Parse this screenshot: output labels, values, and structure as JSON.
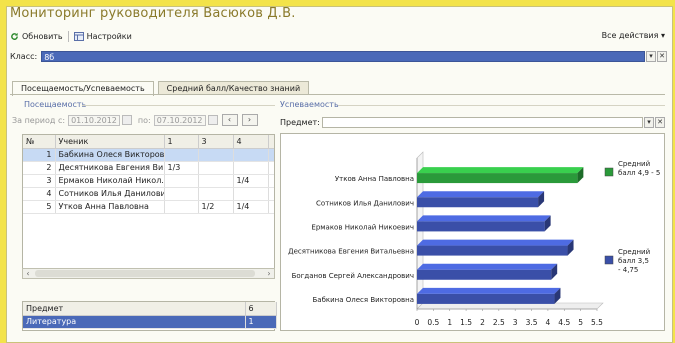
{
  "window": {
    "title": "Мониторинг руководителя Васюков Д.В."
  },
  "toolbar": {
    "refresh_label": "Обновить",
    "settings_label": "Настройки",
    "all_actions_label": "Все действия ▾"
  },
  "class_field": {
    "label": "Класс:",
    "value": "8б"
  },
  "tabs": [
    {
      "label": "Посещаемость/Успеваемость",
      "active": true
    },
    {
      "label": "Средний балл/Качество знаний",
      "active": false
    }
  ],
  "attendance": {
    "group_label": "Посещаемость",
    "period_from_label": "За период с:",
    "period_from": "01.10.2012",
    "period_to_label": "по:",
    "period_to": "07.10.2012",
    "prev_icon": "chevron-left-icon",
    "next_icon": "chevron-right-icon",
    "columns": [
      "№",
      "Ученик",
      "1",
      "3",
      "4",
      ""
    ],
    "rows": [
      {
        "n": "1",
        "name": "Бабкина Олеся Викторовна",
        "c1": "",
        "c3": "",
        "c4": "",
        "selected": true
      },
      {
        "n": "2",
        "name": "Десятникова Евгения Ви...",
        "c1": "1/3",
        "c3": "",
        "c4": "",
        "selected": false
      },
      {
        "n": "3",
        "name": "Ермаков Николай Никол...",
        "c1": "",
        "c3": "",
        "c4": "1/4",
        "selected": false
      },
      {
        "n": "4",
        "name": "Сотников Илья Данилович",
        "c1": "",
        "c3": "",
        "c4": "",
        "selected": false
      },
      {
        "n": "5",
        "name": "Утков Анна Павловна",
        "c1": "",
        "c3": "1/2",
        "c4": "1/4",
        "selected": false
      }
    ]
  },
  "subjects": {
    "columns": [
      "Предмет",
      "6"
    ],
    "rows": [
      {
        "subject": "Литература",
        "value": "1",
        "selected": true
      }
    ]
  },
  "performance": {
    "group_label": "Успеваемость",
    "subject_label": "Предмет:",
    "subject_value": ""
  },
  "colors": {
    "accent_blue": "#4a69b8",
    "bar_blue": "#3a4fa8",
    "bar_green": "#2a9a3a",
    "title": "#8a7a2b",
    "frame": "#f3e34a"
  },
  "chart_data": {
    "type": "bar",
    "orientation": "horizontal",
    "style": "3d",
    "categories": [
      "Утков Анна Павловна",
      "Сотников Илья Данилович",
      "Ермаков Николай Никоевич",
      "Десятникова Евгения Витальевна",
      "Богданов Сергей Александрович",
      "Бабкина Олеся Викторовна"
    ],
    "values": [
      4.9,
      3.7,
      3.9,
      4.6,
      4.1,
      4.2
    ],
    "bar_groups": [
      "green",
      "blue",
      "blue",
      "blue",
      "blue",
      "blue"
    ],
    "xlim": [
      0,
      5.5
    ],
    "x_ticks": [
      "0",
      "0.5",
      "1",
      "1.5",
      "2",
      "2.5",
      "3",
      "3.5",
      "4",
      "4.5",
      "5",
      "5.5"
    ],
    "legend": [
      {
        "name": "Средний балл 4,9 - 5",
        "color": "#2a9a3a"
      },
      {
        "name": "Средний балл 3,5 - 4,75",
        "color": "#3a4fa8"
      }
    ],
    "legend_position": "right",
    "grid": false
  }
}
